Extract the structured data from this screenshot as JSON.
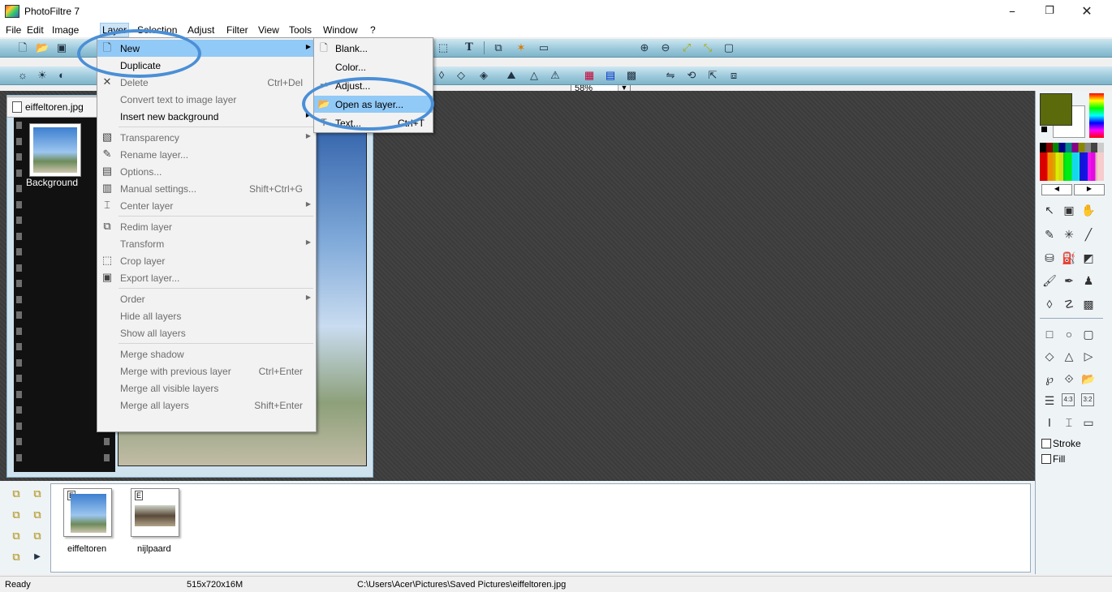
{
  "window": {
    "title": "PhotoFiltre 7",
    "minimize": "–",
    "maximize": "❐",
    "close": "✕"
  },
  "menubar": [
    "File",
    "Edit",
    "Image",
    "Layer",
    "Selection",
    "Adjust",
    "Filter",
    "View",
    "Tools",
    "Window",
    "?"
  ],
  "toolbar": {
    "zoom": "58%"
  },
  "document": {
    "tab_label": "eiffeltoren.jpg",
    "layer_label": "Background"
  },
  "layer_menu": {
    "items": [
      {
        "label": "New",
        "shortcut": "",
        "submenu": true,
        "state": "highlighted",
        "icon": "page-icon"
      },
      {
        "label": "Duplicate",
        "shortcut": "",
        "submenu": false,
        "state": "enabled",
        "icon": ""
      },
      {
        "label": "Delete",
        "shortcut": "Ctrl+Del",
        "submenu": false,
        "state": "disabled",
        "icon": "x-icon"
      },
      {
        "label": "Convert text to image layer",
        "shortcut": "",
        "submenu": false,
        "state": "disabled",
        "icon": ""
      },
      {
        "label": "Insert new background",
        "shortcut": "",
        "submenu": true,
        "state": "enabled",
        "icon": ""
      },
      {
        "label": "Transparency",
        "shortcut": "",
        "submenu": true,
        "state": "disabled",
        "icon": "transparency-icon"
      },
      {
        "label": "Rename layer...",
        "shortcut": "",
        "submenu": false,
        "state": "disabled",
        "icon": "rename-icon"
      },
      {
        "label": "Options...",
        "shortcut": "",
        "submenu": false,
        "state": "disabled",
        "icon": "options-icon"
      },
      {
        "label": "Manual settings...",
        "shortcut": "Shift+Ctrl+G",
        "submenu": false,
        "state": "disabled",
        "icon": "manual-icon"
      },
      {
        "label": "Center layer",
        "shortcut": "",
        "submenu": true,
        "state": "disabled",
        "icon": "center-icon"
      },
      {
        "label": "Redim layer",
        "shortcut": "",
        "submenu": false,
        "state": "disabled",
        "icon": "redim-icon"
      },
      {
        "label": "Transform",
        "shortcut": "",
        "submenu": true,
        "state": "disabled",
        "icon": ""
      },
      {
        "label": "Crop layer",
        "shortcut": "",
        "submenu": false,
        "state": "disabled",
        "icon": "crop-icon"
      },
      {
        "label": "Export layer...",
        "shortcut": "",
        "submenu": false,
        "state": "disabled",
        "icon": "save-icon"
      },
      {
        "label": "Order",
        "shortcut": "",
        "submenu": true,
        "state": "disabled",
        "icon": ""
      },
      {
        "label": "Hide all layers",
        "shortcut": "",
        "submenu": false,
        "state": "disabled",
        "icon": ""
      },
      {
        "label": "Show all layers",
        "shortcut": "",
        "submenu": false,
        "state": "disabled",
        "icon": ""
      },
      {
        "label": "Merge shadow",
        "shortcut": "",
        "submenu": false,
        "state": "disabled",
        "icon": ""
      },
      {
        "label": "Merge with previous layer",
        "shortcut": "Ctrl+Enter",
        "submenu": false,
        "state": "disabled",
        "icon": ""
      },
      {
        "label": "Merge all visible layers",
        "shortcut": "",
        "submenu": false,
        "state": "disabled",
        "icon": ""
      },
      {
        "label": "Merge all layers",
        "shortcut": "Shift+Enter",
        "submenu": false,
        "state": "disabled",
        "icon": ""
      }
    ]
  },
  "new_submenu": {
    "items": [
      {
        "label": "Blank...",
        "state": "enabled",
        "icon": "blank-page-icon"
      },
      {
        "label": "Color...",
        "state": "enabled",
        "icon": ""
      },
      {
        "label": "Adjust...",
        "state": "enabled",
        "icon": "adjust-icon"
      },
      {
        "label": "Open as layer...",
        "state": "highlighted",
        "icon": "folder-icon"
      },
      {
        "label": "Text...",
        "state": "enabled",
        "icon": "text-icon"
      }
    ],
    "text_shortcut": "Ctrl+T"
  },
  "right_panel": {
    "stroke_label": "Stroke",
    "fill_label": "Fill",
    "ratio1": "4:3",
    "ratio2": "3:2"
  },
  "thumbnails": [
    {
      "label": "eiffeltoren",
      "badge": "E"
    },
    {
      "label": "nijlpaard",
      "badge": "E"
    }
  ],
  "statusbar": {
    "status": "Ready",
    "dimensions": "515x720x16M",
    "path": "C:\\Users\\Acer\\Pictures\\Saved Pictures\\eiffeltoren.jpg"
  },
  "colors": {
    "foreground": "#5b6a0a",
    "highlight": "#91c9f7",
    "annotation_ring": "#4a8fd6"
  }
}
